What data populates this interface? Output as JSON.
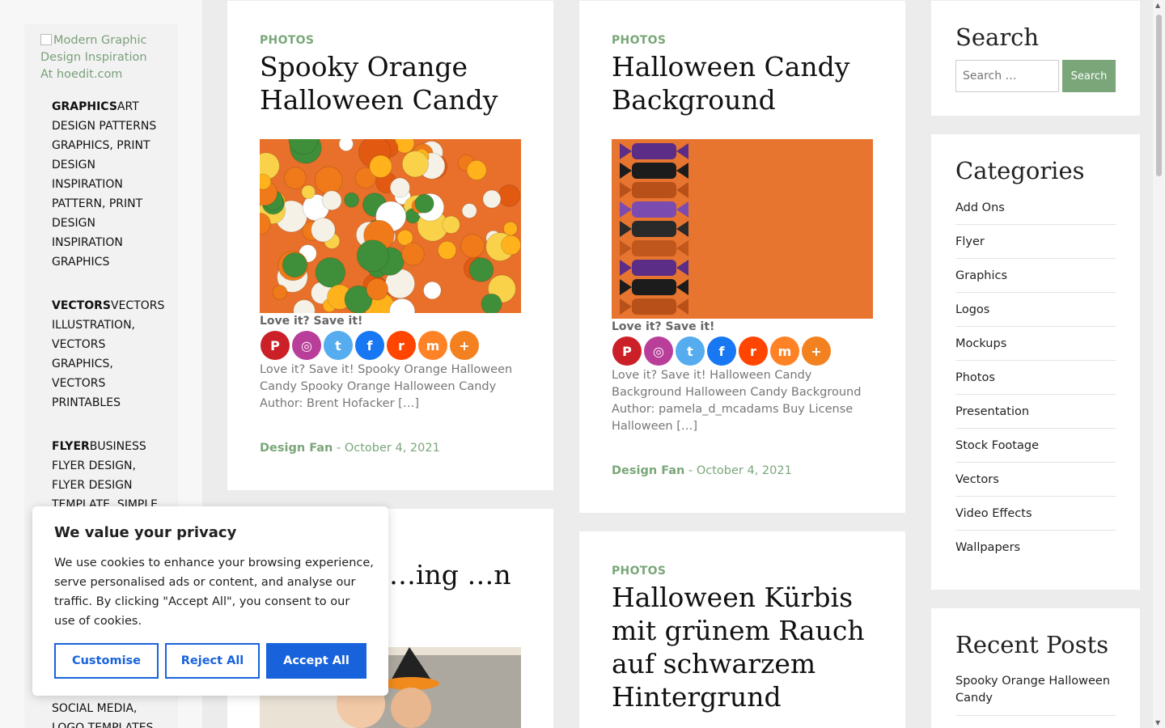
{
  "logo_alt": "Modern Graphic Design Inspiration At hoedit.com",
  "menu": [
    {
      "head": "GRAPHICS",
      "text": "ART DESIGN PATTERNS GRAPHICS, PRINT DESIGN INSPIRATION PATTERN, PRINT DESIGN INSPIRATION GRAPHICS"
    },
    {
      "head": "VECTORS",
      "text": "VECTORS ILLUSTRATION, VECTORS GRAPHICS, VECTORS PRINTABLES"
    },
    {
      "head": "FLYER",
      "text": "BUSINESS FLYER DESIGN, FLYER DESIGN TEMPLATE, SIMPLE"
    },
    {
      "head": "",
      "text": "SOCIAL MEDIA, LOGO TEMPLATES"
    }
  ],
  "posts": [
    {
      "category": "PHOTOS",
      "title": "Spooky Orange Halloween Candy",
      "love": "Love it? Save it!",
      "excerpt": "Love it? Save it! Spooky Orange Halloween Candy Spooky Orange Halloween Candy Author: Brent Hofacker […]",
      "author": "Design Fan",
      "date": "October 4, 2021"
    },
    {
      "category": "PHOTOS",
      "title": "Halloween Candy Background",
      "love": "Love it? Save it!",
      "excerpt": "Love it? Save it! Halloween Candy Background Halloween Candy Background Author: pamela_d_mcadams Buy License Halloween […]",
      "author": "Design Fan",
      "date": "October 4, 2021"
    },
    {
      "category": "",
      "title": "…ing …n",
      "love": "",
      "excerpt": "",
      "author": "",
      "date": ""
    },
    {
      "category": "PHOTOS",
      "title": "Halloween Kürbis mit grünem Rauch auf schwarzem Hintergrund",
      "love": "",
      "excerpt": "",
      "author": "",
      "date": ""
    }
  ],
  "meta_separator": " - ",
  "share_icons": [
    "pinterest-icon",
    "instagram-icon",
    "twitter-icon",
    "facebook-icon",
    "reddit-icon",
    "mix-icon",
    "more-icon"
  ],
  "search_widget": {
    "title": "Search",
    "placeholder": "Search …",
    "button": "Search"
  },
  "categories_widget": {
    "title": "Categories",
    "items": [
      "Add Ons",
      "Flyer",
      "Graphics",
      "Logos",
      "Mockups",
      "Photos",
      "Presentation",
      "Stock Footage",
      "Vectors",
      "Video Effects",
      "Wallpapers"
    ]
  },
  "recent_widget": {
    "title": "Recent Posts",
    "items": [
      "Spooky Orange Halloween Candy"
    ]
  },
  "cookie": {
    "title": "We value your privacy",
    "text": "We use cookies to enhance your browsing experience, serve personalised ads or content, and analyse our traffic. By clicking \"Accept All\", you consent to our use of cookies.",
    "customise": "Customise",
    "reject": "Reject All",
    "accept": "Accept All"
  },
  "colors": {
    "accent": "#7aa67a",
    "cookie_blue": "#1863dc"
  }
}
